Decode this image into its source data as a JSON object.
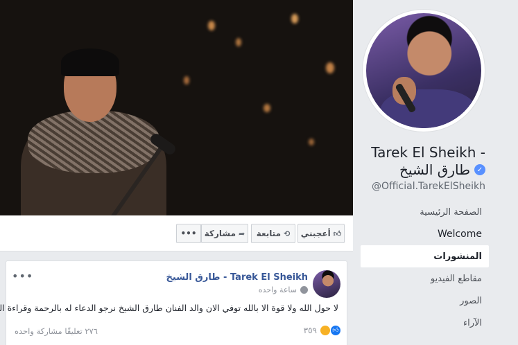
{
  "action_bar": {
    "more_label": "•••",
    "share_label": "مشاركة",
    "follow_label": "متابعة",
    "like_label": "أعجبني"
  },
  "profile": {
    "name_line1": "Tarek El Sheikh -",
    "name_line2": "طارق الشيخ",
    "handle": "@Official.TarekElSheikh"
  },
  "nav": {
    "items": [
      {
        "label": "الصفحة الرئيسية"
      },
      {
        "label": "Welcome"
      },
      {
        "label": "المنشورات"
      },
      {
        "label": "مقاطع الفيديو"
      },
      {
        "label": "الصور"
      },
      {
        "label": "الآراء"
      }
    ],
    "active_index": 2
  },
  "post": {
    "more_label": "•••",
    "author": "طارق الشيخ - Tarek El Sheikh",
    "time": "ساعة واحده",
    "text": "لا حول الله ولا قوة الا بالله توفي الان والد الفنان طارق الشيخ نرجو الدعاء له بالرحمة وقراءة الفاتحة",
    "comments_shares": "٢٧٦ تعليقًا  مشاركة واحده",
    "reactions_count": "٣٥٩"
  },
  "colors": {
    "link": "#385898",
    "verified": "#5890ff",
    "page_bg": "#e9ebee"
  }
}
